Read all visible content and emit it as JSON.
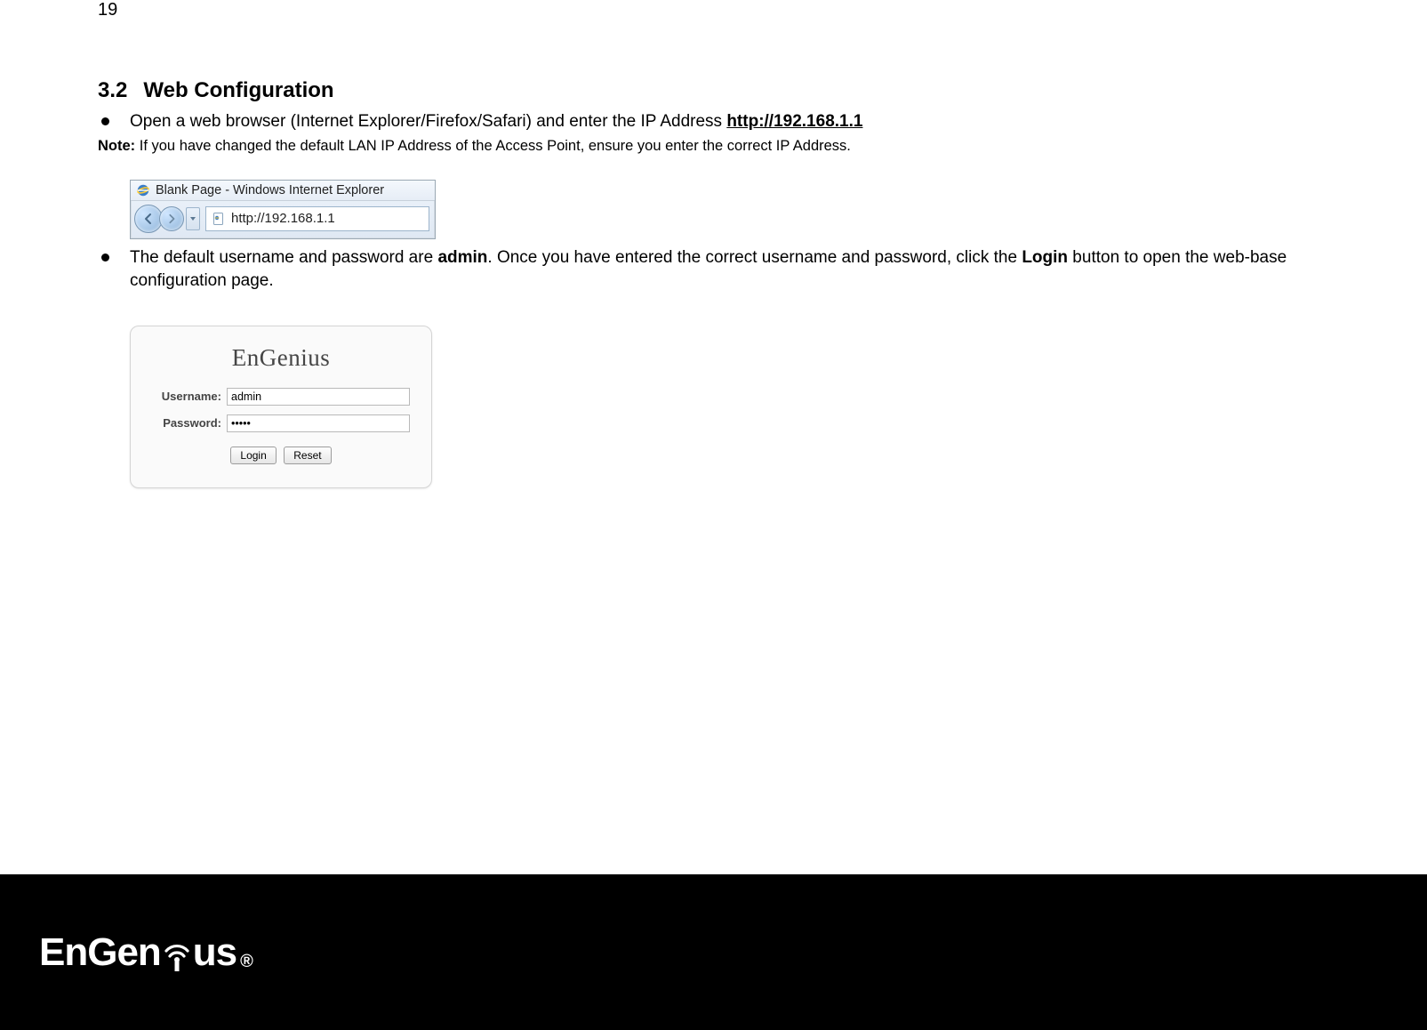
{
  "page_number": "19",
  "heading": {
    "number": "3.2",
    "title": "Web Configuration"
  },
  "bullet1": {
    "pre": "Open a web browser (Internet Explorer/Firefox/Safari) and enter the IP Address ",
    "link": "http://192.168.1.1"
  },
  "note": {
    "label": "Note:",
    "text": " If you have changed the default LAN IP Address of the Access Point, ensure you enter the correct IP Address."
  },
  "ie": {
    "title": "Blank Page - Windows Internet Explorer",
    "url": "http://192.168.1.1"
  },
  "bullet2": {
    "p1": "The default username and password are ",
    "admin": "admin",
    "p2": ". Once you have entered the correct username and password, click the ",
    "login_word": "Login",
    "p3": " button to open the web-base configuration page."
  },
  "login": {
    "brand": "EnGenius",
    "username_label": "Username:",
    "username_value": "admin",
    "password_label": "Password:",
    "password_value": "•••••",
    "login_btn": "Login",
    "reset_btn": "Reset"
  },
  "footer_brand": {
    "part1": "EnGen",
    "part2": "us",
    "reg": "®"
  }
}
